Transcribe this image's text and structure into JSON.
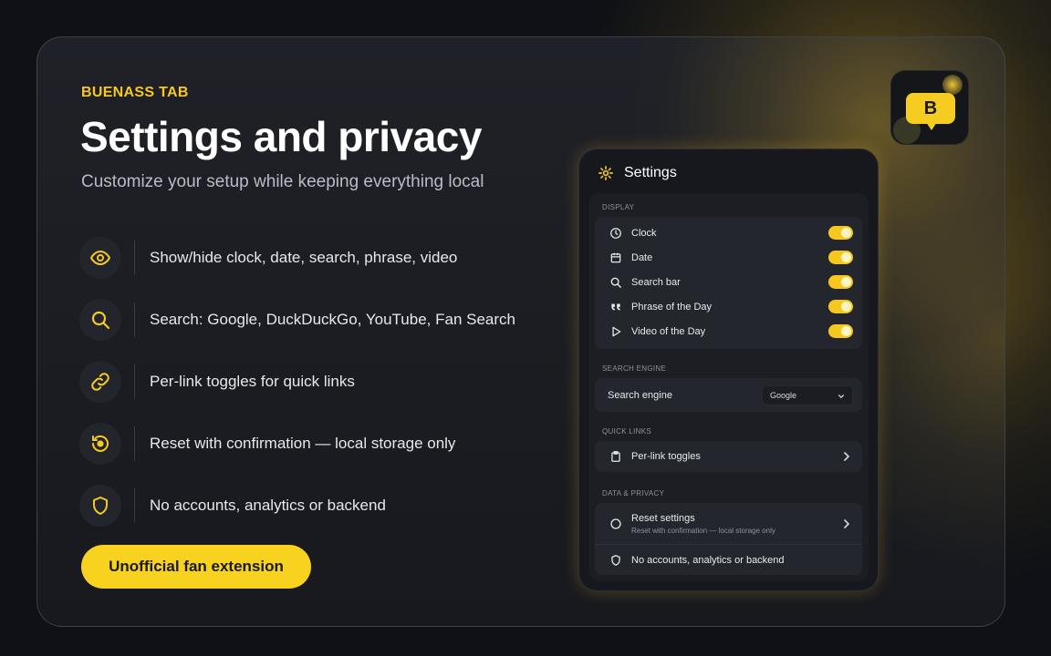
{
  "brand": {
    "eyebrow": "BUENASS TAB",
    "logo_letter": "B",
    "accent": "#f7c824"
  },
  "headline": "Settings and privacy",
  "subhead": "Customize your setup while keeping everything local",
  "features": [
    {
      "icon": "eye-icon",
      "text": "Show/hide clock, date, search, phrase, video"
    },
    {
      "icon": "search-icon",
      "text": "Search: Google, DuckDuckGo, YouTube, Fan Search"
    },
    {
      "icon": "link-icon",
      "text": "Per-link toggles for quick links"
    },
    {
      "icon": "reset-icon",
      "text": "Reset with confirmation — local storage only"
    },
    {
      "icon": "shield-icon",
      "text": "No accounts, analytics or backend"
    }
  ],
  "cta_label": "Unofficial fan extension",
  "panel": {
    "title": "Settings",
    "display": {
      "label": "DISPLAY",
      "items": [
        {
          "icon": "clock-icon",
          "label": "Clock",
          "enabled": true
        },
        {
          "icon": "calendar-icon",
          "label": "Date",
          "enabled": true
        },
        {
          "icon": "search-icon",
          "label": "Search bar",
          "enabled": true
        },
        {
          "icon": "quote-icon",
          "label": "Phrase of the Day",
          "enabled": true
        },
        {
          "icon": "play-icon",
          "label": "Video of the Day",
          "enabled": true
        }
      ]
    },
    "search_engine": {
      "label": "SEARCH ENGINE",
      "row_label": "Search engine",
      "selected": "Google"
    },
    "quick_links": {
      "label": "QUICK LINKS",
      "row_label": "Per-link toggles"
    },
    "data_privacy": {
      "label": "DATA & PRIVACY",
      "reset_label": "Reset settings",
      "reset_sub": "Reset with confirmation — local storage only",
      "privacy_label": "No accounts, analytics or backend"
    }
  }
}
